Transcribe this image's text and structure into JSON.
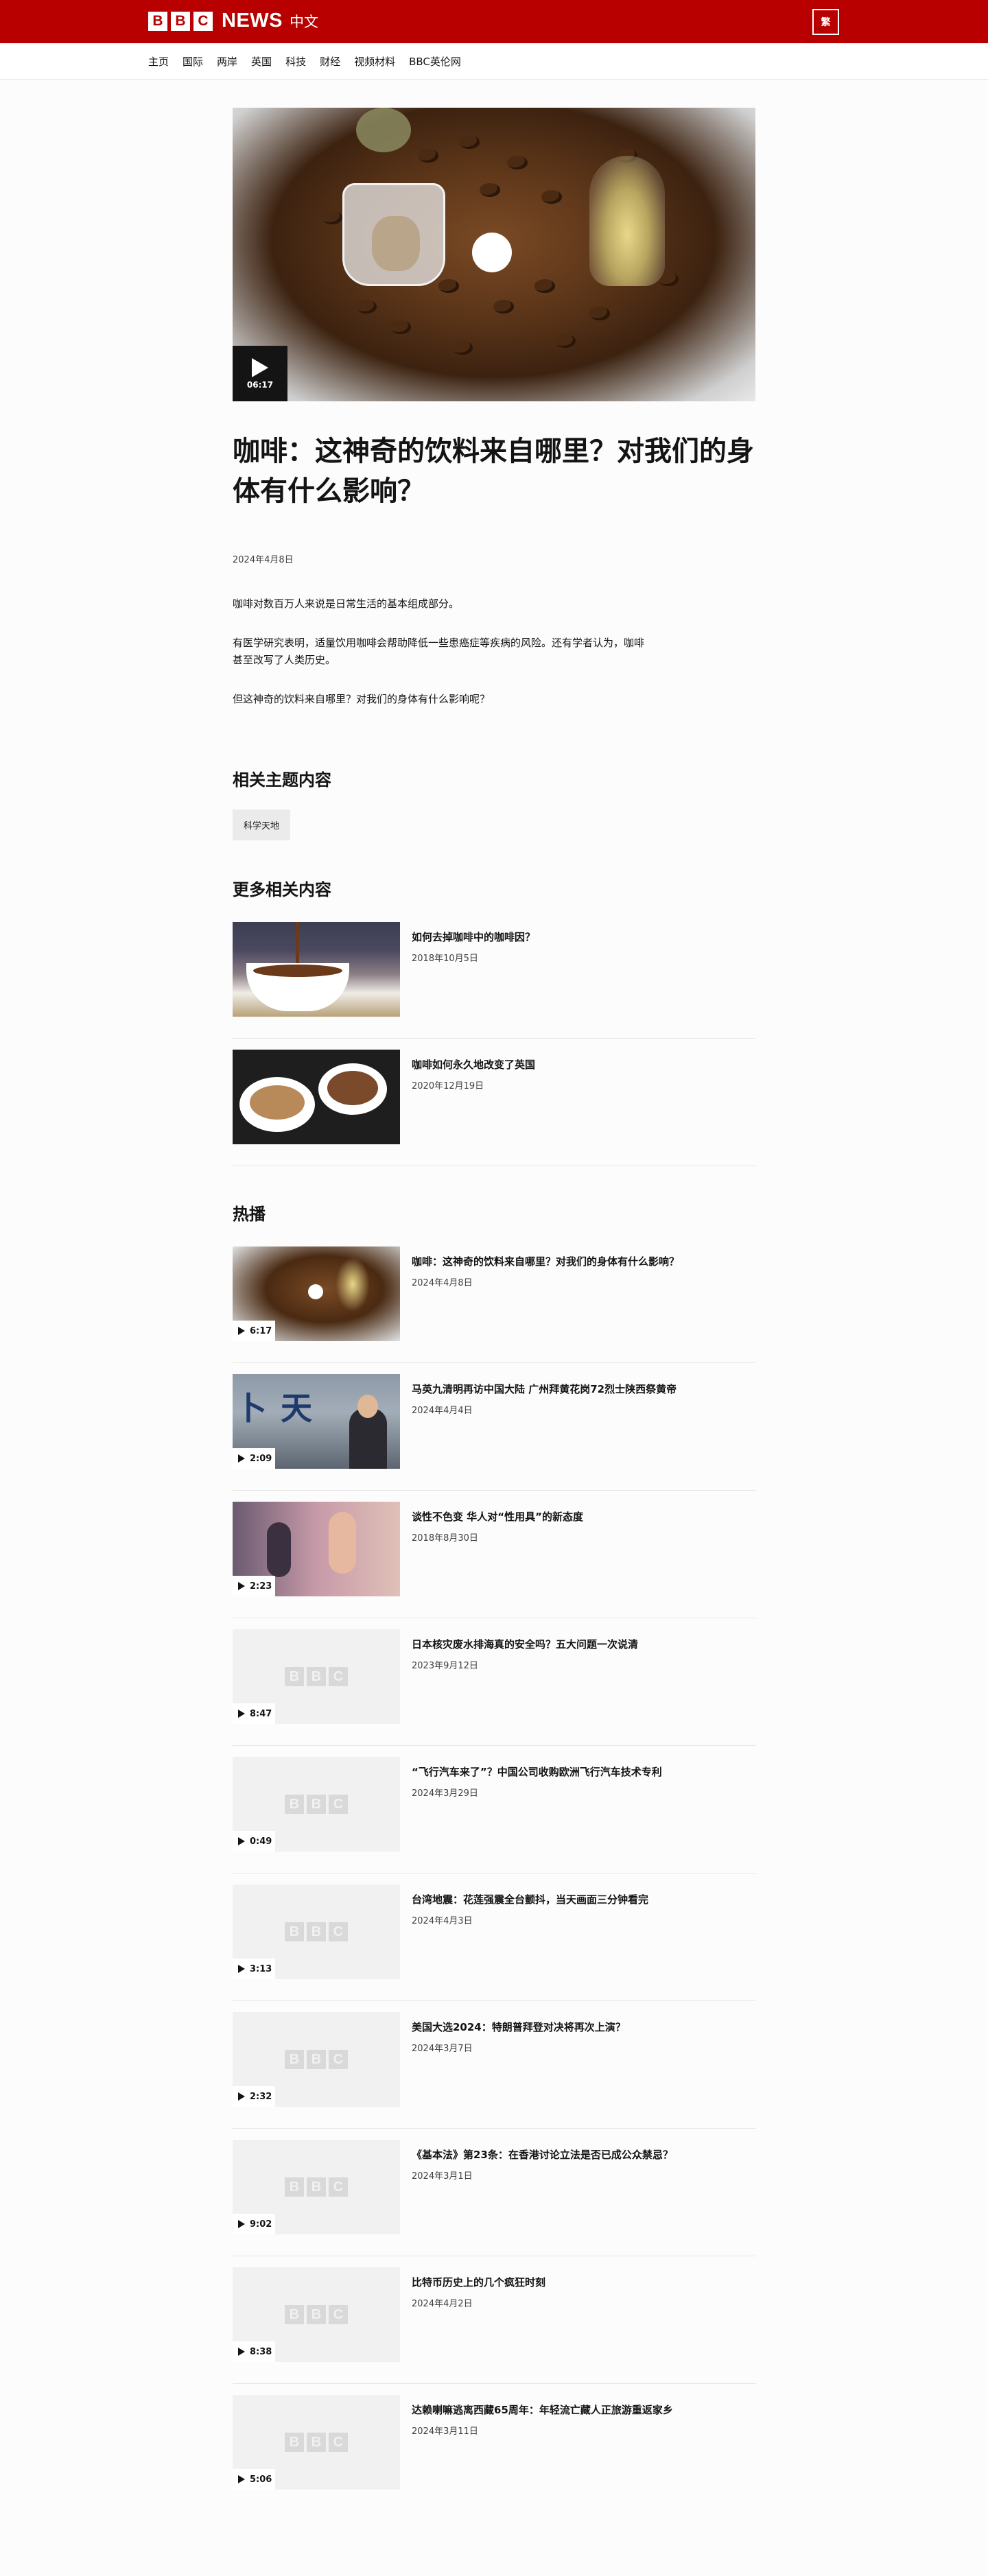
{
  "header": {
    "brand_letters": [
      "B",
      "B",
      "C"
    ],
    "brand_news": "NEWS",
    "brand_lang": "中文",
    "lang_toggle": "繁"
  },
  "nav": [
    "主页",
    "国际",
    "两岸",
    "英国",
    "科技",
    "财经",
    "视频材料",
    "BBC英伦网"
  ],
  "hero": {
    "duration": "06:17"
  },
  "article": {
    "title": "咖啡：这神奇的饮料来自哪里？对我们的身体有什么影响？",
    "date": "2024年4月8日",
    "paragraphs": [
      "咖啡对数百万人来说是日常生活的基本组成部分。",
      "有医学研究表明，适量饮用咖啡会帮助降低一些患癌症等疾病的风险。还有学者认为，咖啡甚至改写了人类历史。",
      "但这神奇的饮料来自哪里？对我们的身体有什么影响呢？"
    ]
  },
  "topics": {
    "heading": "相关主题内容",
    "tags": [
      "科学天地"
    ]
  },
  "related": {
    "heading": "更多相关内容",
    "items": [
      {
        "title": "如何去掉咖啡中的咖啡因？",
        "date": "2018年10月5日"
      },
      {
        "title": "咖啡如何永久地改变了英国",
        "date": "2020年12月19日"
      }
    ]
  },
  "popular": {
    "heading": "热播",
    "items": [
      {
        "title": "咖啡：这神奇的饮料来自哪里？对我们的身体有什么影响？",
        "date": "2024年4月8日",
        "duration": "6:17"
      },
      {
        "title": "马英九清明再访中国大陆 广州拜黄花岗72烈士陕西祭黄帝",
        "date": "2024年4月4日",
        "duration": "2:09"
      },
      {
        "title": "谈性不色变 华人对“性用具”的新态度",
        "date": "2018年8月30日",
        "duration": "2:23"
      },
      {
        "title": "日本核灾废水排海真的安全吗？五大问题一次说清",
        "date": "2023年9月12日",
        "duration": "8:47"
      },
      {
        "title": "“飞行汽车来了”？中国公司收购欧洲飞行汽车技术专利",
        "date": "2024年3月29日",
        "duration": "0:49"
      },
      {
        "title": "台湾地震：花莲强震全台颤抖，当天画面三分钟看完",
        "date": "2024年4月3日",
        "duration": "3:13"
      },
      {
        "title": "美国大选2024：特朗普拜登对决将再次上演？",
        "date": "2024年3月7日",
        "duration": "2:32"
      },
      {
        "title": "《基本法》第23条：在香港讨论立法是否已成公众禁忌？",
        "date": "2024年3月1日",
        "duration": "9:02"
      },
      {
        "title": "比特币历史上的几个疯狂时刻",
        "date": "2024年4月2日",
        "duration": "8:38"
      },
      {
        "title": "达赖喇嘛逃离西藏65周年：年轻流亡藏人正旅游重返家乡",
        "date": "2024年3月11日",
        "duration": "5:06"
      }
    ]
  }
}
